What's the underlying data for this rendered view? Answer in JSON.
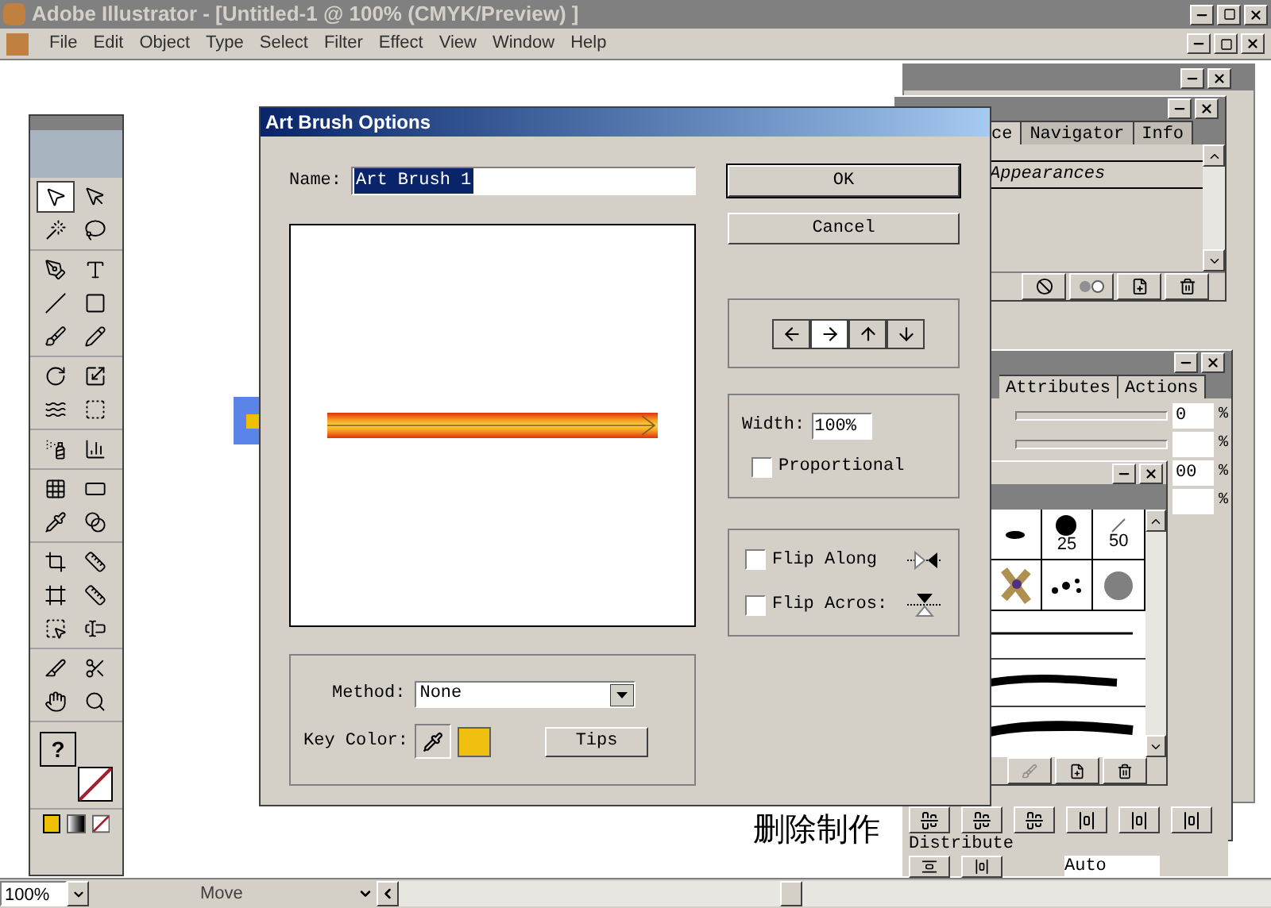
{
  "window": {
    "title": "Adobe Illustrator - [Untitled-1 @ 100% (CMYK/Preview) ]"
  },
  "menu": [
    "File",
    "Edit",
    "Object",
    "Type",
    "Select",
    "Filter",
    "Effect",
    "View",
    "Window",
    "Help"
  ],
  "toolbox": {
    "groups": [
      [
        {
          "kind": "selection",
          "selected": true
        },
        {
          "kind": "direct-selection",
          "selected": false
        },
        {
          "kind": "magic-wand",
          "selected": false
        },
        {
          "kind": "lasso",
          "selected": false
        }
      ],
      [
        {
          "kind": "pen",
          "selected": false
        },
        {
          "kind": "type",
          "selected": false
        },
        {
          "kind": "line",
          "selected": false
        },
        {
          "kind": "rectangle",
          "selected": false
        },
        {
          "kind": "paintbrush",
          "selected": false
        },
        {
          "kind": "pencil",
          "selected": false
        }
      ],
      [
        {
          "kind": "rotate",
          "selected": false
        },
        {
          "kind": "scale",
          "selected": false
        },
        {
          "kind": "warp",
          "selected": false
        },
        {
          "kind": "free-transform",
          "selected": false
        }
      ],
      [
        {
          "kind": "spray",
          "selected": false
        },
        {
          "kind": "graph",
          "selected": false
        }
      ],
      [
        {
          "kind": "mesh",
          "selected": false
        },
        {
          "kind": "gradient",
          "selected": false
        },
        {
          "kind": "eyedropper",
          "selected": false
        },
        {
          "kind": "blend",
          "selected": false
        }
      ],
      [
        {
          "kind": "crop",
          "selected": false
        },
        {
          "kind": "measure",
          "selected": false
        },
        {
          "kind": "frame",
          "selected": false
        },
        {
          "kind": "ruler",
          "selected": false
        },
        {
          "kind": "slice",
          "selected": false
        },
        {
          "kind": "text-box",
          "selected": false
        }
      ],
      [
        {
          "kind": "knife",
          "selected": false
        },
        {
          "kind": "scissors",
          "selected": false
        },
        {
          "kind": "hand",
          "selected": false
        },
        {
          "kind": "zoom",
          "selected": false
        }
      ]
    ],
    "fill_label": "?"
  },
  "canvas_text": "删除制作",
  "dialog": {
    "title": "Art Brush Options",
    "name_label": "Name:",
    "name_value": "Art Brush 1",
    "buttons": [
      "OK",
      "Cancel"
    ],
    "directions": [
      {
        "kind": "left",
        "selected": false
      },
      {
        "kind": "right",
        "selected": true
      },
      {
        "kind": "up",
        "selected": false
      },
      {
        "kind": "down",
        "selected": false
      }
    ],
    "width_label": "Width:",
    "width_value": "100%",
    "checks": [
      {
        "label": "Proportional",
        "checked": false
      }
    ],
    "flips": [
      {
        "kind": "along",
        "label": "Flip Along",
        "checked": false
      },
      {
        "kind": "across",
        "label": "Flip Acros:",
        "checked": false
      }
    ],
    "method_label": "Method:",
    "method_value": "None",
    "key_color_label": "Key Color:",
    "tips": "Tips"
  },
  "appearance_panel": {
    "tabs": [
      {
        "label": "ce",
        "selected": true
      },
      {
        "label": "Navigator",
        "selected": false
      },
      {
        "label": "Info",
        "selected": false
      }
    ],
    "row": "Appearances"
  },
  "attributes_panel": {
    "tabs": [
      {
        "label": "Attributes",
        "selected": false
      },
      {
        "label": "Actions",
        "selected": false
      }
    ],
    "fields": [
      {
        "value": "0",
        "unit": "%"
      },
      {
        "unit": "%"
      },
      {
        "value": "00",
        "unit": "%"
      },
      {
        "unit": "%"
      }
    ]
  },
  "brushes_panel": {
    "cells": [
      {
        "kind": "blob"
      },
      {
        "kind": "dot",
        "label": "25"
      },
      {
        "kind": "stroke",
        "label": "50"
      },
      {
        "kind": "butterfly"
      },
      {
        "kind": "splatter"
      },
      {
        "kind": "ink"
      }
    ]
  },
  "align_panel": {
    "heading": "Distribute",
    "spacing": "Auto"
  },
  "status_bar": {
    "zoom": "100%",
    "tool": "Move"
  }
}
